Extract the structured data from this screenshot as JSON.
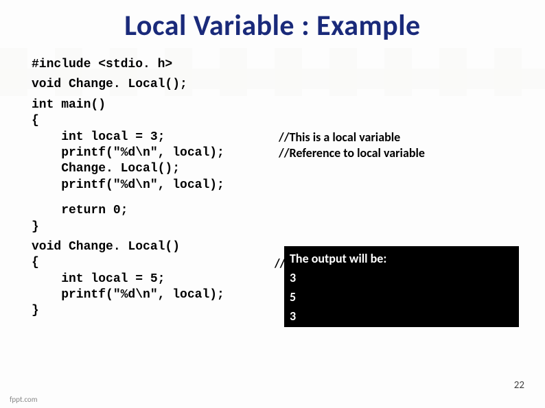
{
  "title": "Local Variable : Example",
  "code": {
    "l1": "#include <stdio. h>",
    "l2": "void Change. Local();",
    "l3": "int main()",
    "l4": "{",
    "l5": "    int local = 3;",
    "l6": "    printf(\"%d\\n\", local);",
    "l7": "    Change. Local();",
    "l8": "    printf(\"%d\\n\", local);",
    "l9": "    return 0;",
    "l10": "}",
    "l11": "void Change. Local()",
    "l12": "{",
    "l13": "    int local = 5;",
    "l14": "    printf(\"%d\\n\", local);",
    "l15": "}"
  },
  "comments": {
    "c1": "//This is a local variable",
    "c2": "//Reference to local variable",
    "partial": "//"
  },
  "output": {
    "heading": "The output will be:",
    "lines": [
      "3",
      "5",
      "3"
    ]
  },
  "page_number": "22",
  "footer": "fppt.com"
}
